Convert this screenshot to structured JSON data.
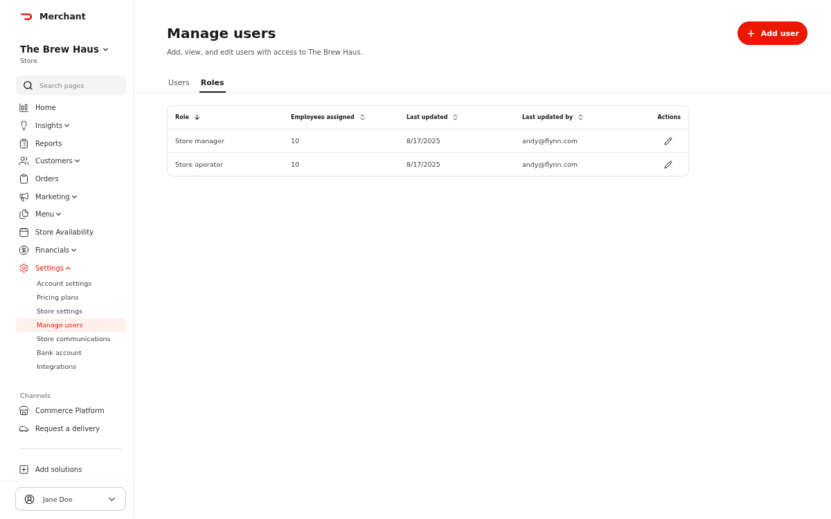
{
  "brand": {
    "name": "Merchant"
  },
  "store": {
    "name": "The Brew Haus",
    "type": "Store"
  },
  "search": {
    "placeholder": "Search pages"
  },
  "nav": [
    {
      "label": "Home",
      "selected": false
    },
    {
      "label": "Insights",
      "selected": false,
      "expanded": false
    },
    {
      "label": "Reports",
      "selected": false
    },
    {
      "label": "Customers",
      "selected": false,
      "expanded": false
    },
    {
      "label": "Orders",
      "selected": false
    },
    {
      "label": "Marketing",
      "selected": false,
      "expanded": false
    },
    {
      "label": "Menu",
      "selected": false,
      "expanded": false
    },
    {
      "label": "Store Availability",
      "selected": false
    },
    {
      "label": "Financials",
      "selected": false,
      "expanded": false
    },
    {
      "label": "Settings",
      "selected": true,
      "expanded": true,
      "children": [
        {
          "label": "Account settings",
          "selected": false
        },
        {
          "label": "Pricing plans",
          "selected": false
        },
        {
          "label": "Store settings",
          "selected": false
        },
        {
          "label": "Manage users",
          "selected": true
        },
        {
          "label": "Store communications",
          "selected": false
        },
        {
          "label": "Bank account",
          "selected": false
        },
        {
          "label": "Integrations",
          "selected": false
        }
      ]
    }
  ],
  "channels": {
    "heading": "Channels",
    "items": [
      {
        "label": "Commerce Platform"
      },
      {
        "label": "Request a delivery"
      }
    ]
  },
  "add_solutions": "Add solutions",
  "user": {
    "name": "Jane Doe"
  },
  "page": {
    "title": "Manage users",
    "subtitle": "Add, view, and edit users with access to The Brew Haus.",
    "action": "Add user"
  },
  "tabs": [
    {
      "label": "Users",
      "selected": false
    },
    {
      "label": "Roles",
      "selected": true
    }
  ],
  "table": {
    "columns": [
      {
        "label": "Role",
        "sorted": true
      },
      {
        "label": "Employees assigned",
        "sorted": false
      },
      {
        "label": "Last updated",
        "sorted": false
      },
      {
        "label": "Last updated by",
        "sorted": false
      },
      {
        "label": "Actions"
      }
    ],
    "rows": [
      {
        "role": "Store manager",
        "employees": "10",
        "updated": "8/17/2025",
        "updated_by": "andy@flynn.com"
      },
      {
        "role": "Store operator",
        "employees": "10",
        "updated": "8/17/2025",
        "updated_by": "andy@flynn.com"
      }
    ]
  }
}
